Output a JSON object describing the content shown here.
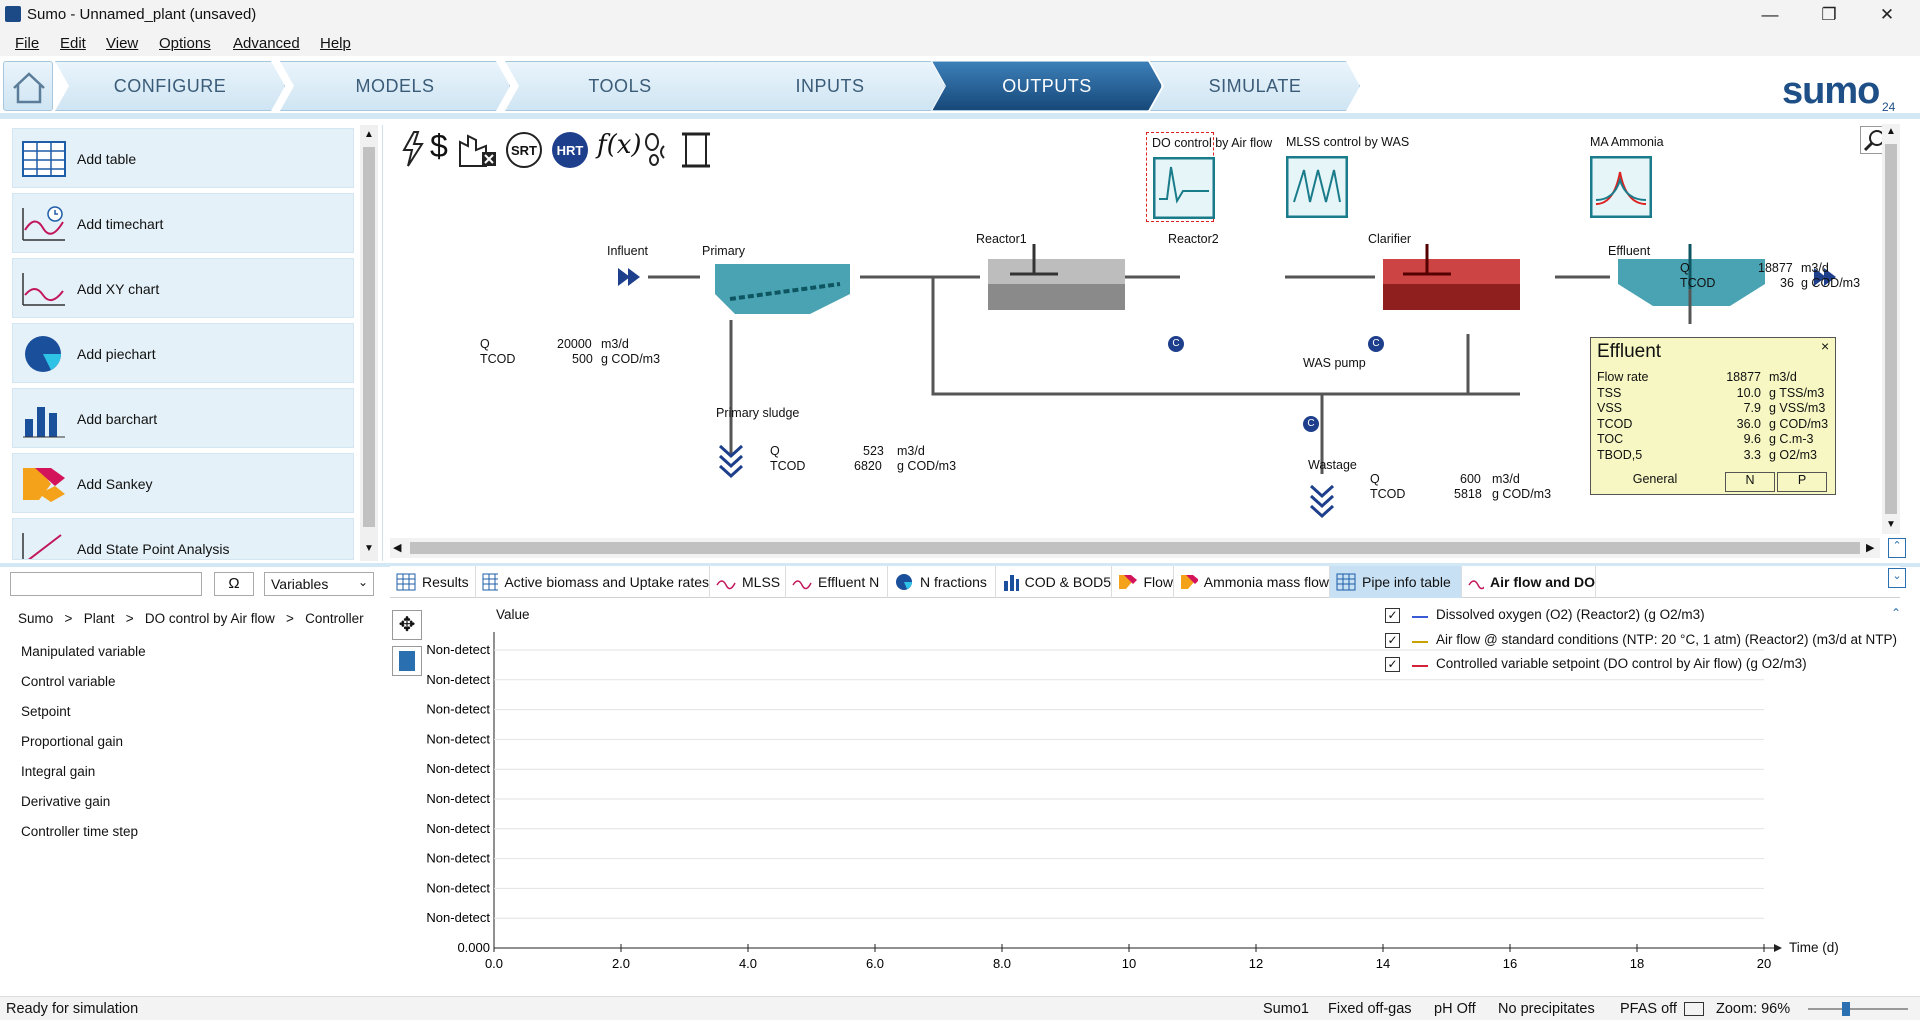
{
  "window": {
    "title": "Sumo - Unnamed_plant (unsaved)"
  },
  "menu": [
    "File",
    "Edit",
    "View",
    "Options",
    "Advanced",
    "Help"
  ],
  "nav_tabs": [
    "CONFIGURE",
    "MODELS",
    "TOOLS",
    "INPUTS",
    "OUTPUTS",
    "SIMULATE"
  ],
  "nav_active": "OUTPUTS",
  "logo": {
    "text": "sumo",
    "sub": "24"
  },
  "tools": [
    "Add table",
    "Add timechart",
    "Add XY chart",
    "Add piechart",
    "Add barchart",
    "Add Sankey",
    "Add State Point Analysis"
  ],
  "search": {
    "value": "",
    "omega": "Ω",
    "dropdown": "Variables"
  },
  "breadcrumb": {
    "parts": [
      "Sumo",
      ">",
      "Plant",
      ">",
      "DO control by Air flow",
      ">",
      "Controller"
    ]
  },
  "variables": [
    "Manipulated variable",
    "Control variable",
    "Setpoint",
    "Proportional gain",
    "Integral gain",
    "Derivative gain",
    "Controller time step"
  ],
  "diagram": {
    "toolbar_icons": [
      "lightning-icon",
      "dollar-icon",
      "factory-icon",
      "srt-icon",
      "hrt-icon",
      "function-icon",
      "footprint-icon",
      "scroll-icon"
    ],
    "srt": "SRT",
    "hrt": "HRT",
    "fx": "f(x)",
    "controllers": [
      {
        "label": "DO control by Air flow"
      },
      {
        "label": "MLSS control by WAS"
      },
      {
        "label": "MA Ammonia"
      }
    ],
    "units": {
      "influent": "Influent",
      "primary": "Primary",
      "reactor1": "Reactor1",
      "reactor2": "Reactor2",
      "clarifier": "Clarifier",
      "effluent": "Effluent",
      "was_pump": "WAS pump",
      "primary_sludge": "Primary sludge",
      "wastage": "Wastage"
    },
    "c_badge": "C",
    "influent_values": {
      "q_label": "Q",
      "q": "20000",
      "q_unit": "m3/d",
      "tcod_label": "TCOD",
      "tcod": "500",
      "tcod_unit": "g COD/m3"
    },
    "primary_sludge_values": {
      "q_label": "Q",
      "q": "523",
      "q_unit": "m3/d",
      "tcod_label": "TCOD",
      "tcod": "6820",
      "tcod_unit": "g COD/m3"
    },
    "wastage_values": {
      "q_label": "Q",
      "q": "600",
      "q_unit": "m3/d",
      "tcod_label": "TCOD",
      "tcod": "5818",
      "tcod_unit": "g COD/m3"
    },
    "effluent_values": {
      "q_label": "Q",
      "q": "18877",
      "q_unit": "m3/d",
      "tcod_label": "TCOD",
      "tcod": "36",
      "tcod_unit": "g COD/m3"
    },
    "effluent_box": {
      "title": "Effluent",
      "close": "×",
      "rows": [
        {
          "label": "Flow rate",
          "value": "18877",
          "unit": "m3/d"
        },
        {
          "label": "TSS",
          "value": "10.0",
          "unit": "g TSS/m3"
        },
        {
          "label": "VSS",
          "value": "7.9",
          "unit": "g VSS/m3"
        },
        {
          "label": "TCOD",
          "value": "36.0",
          "unit": "g COD/m3"
        },
        {
          "label": "TOC",
          "value": "9.6",
          "unit": "g C.m-3"
        },
        {
          "label": "TBOD,5",
          "value": "3.3",
          "unit": "g O2/m3"
        }
      ],
      "tabs": [
        "General",
        "N",
        "P"
      ]
    }
  },
  "bottom_tabs": [
    "Results",
    "Active biomass and Uptake rates",
    "MLSS",
    "Effluent N",
    "N fractions",
    "COD & BOD5",
    "Flow",
    "Ammonia mass flow",
    "Pipe info table",
    "Air flow and DO"
  ],
  "bottom_tab_selected": "Pipe info table",
  "bottom_tab_bold": "Air flow and DO",
  "chart_data": {
    "type": "line",
    "title": "",
    "ylabel": "Value",
    "xlabel": "Time  (d)",
    "x_ticks": [
      "0.0",
      "2.0",
      "4.0",
      "6.0",
      "8.0",
      "10",
      "12",
      "14",
      "16",
      "18",
      "20"
    ],
    "y_ticks": [
      "Non-detect",
      "Non-detect",
      "Non-detect",
      "Non-detect",
      "Non-detect",
      "Non-detect",
      "Non-detect",
      "Non-detect",
      "Non-detect",
      "Non-detect",
      "0.000"
    ],
    "xlim": [
      0,
      20
    ],
    "grid": true,
    "legend_position": "top-right",
    "series": [
      {
        "name": "Dissolved oxygen (O2) (Reactor2) (g O2/m3)",
        "color": "#3b5bd6",
        "values": []
      },
      {
        "name": "Air flow @ standard conditions (NTP: 20 °C, 1 atm) (Reactor2) (m3/d at NTP)",
        "color": "#c9a400",
        "values": []
      },
      {
        "name": "Controlled variable setpoint (DO control by Air flow) (g O2/m3)",
        "color": "#d2233a",
        "values": []
      }
    ],
    "check": "✓"
  },
  "status": {
    "left": "Ready for simulation",
    "items": [
      "Sumo1",
      "Fixed off-gas",
      "pH Off",
      "No precipitates",
      "PFAS off"
    ],
    "zoom": "Zoom: 96%"
  },
  "window_controls": {
    "min": "—",
    "max": "❐",
    "close": "✕"
  }
}
